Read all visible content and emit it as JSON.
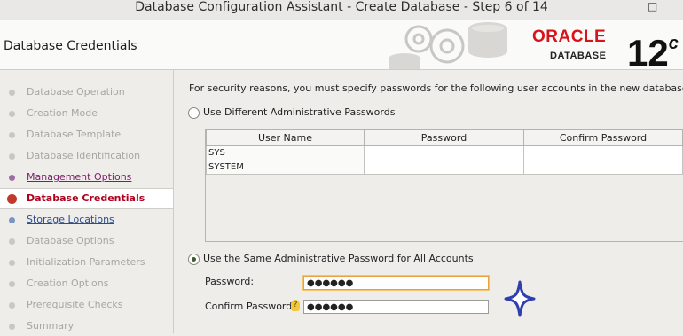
{
  "window": {
    "title": "Database Configuration Assistant - Create Database - Step 6 of 14",
    "minimize": "_",
    "maximize": "□"
  },
  "header": {
    "page_title": "Database Credentials",
    "logo_text": "ORACLE",
    "logo_sub": "DATABASE",
    "version": "12",
    "version_sup": "c"
  },
  "sidebar": {
    "items": [
      {
        "label": "Database Operation",
        "state": "disabled"
      },
      {
        "label": "Creation Mode",
        "state": "disabled"
      },
      {
        "label": "Database Template",
        "state": "disabled"
      },
      {
        "label": "Database Identification",
        "state": "disabled"
      },
      {
        "label": "Management Options",
        "state": "visited"
      },
      {
        "label": "Database Credentials",
        "state": "active"
      },
      {
        "label": "Storage Locations",
        "state": "link"
      },
      {
        "label": "Database Options",
        "state": "disabled"
      },
      {
        "label": "Initialization Parameters",
        "state": "disabled"
      },
      {
        "label": "Creation Options",
        "state": "disabled"
      },
      {
        "label": "Prerequisite Checks",
        "state": "disabled"
      },
      {
        "label": "Summary",
        "state": "disabled"
      }
    ]
  },
  "main": {
    "intro": "For security reasons, you must specify passwords for the following user accounts in the new database.",
    "option_different": "Use Different Administrative Passwords",
    "option_same": "Use the Same Administrative Password for All Accounts",
    "selected_option": "same",
    "table": {
      "columns": [
        "User Name",
        "Password",
        "Confirm Password"
      ],
      "rows": [
        {
          "user": "SYS",
          "password": "",
          "confirm": ""
        },
        {
          "user": "SYSTEM",
          "password": "",
          "confirm": ""
        }
      ]
    },
    "password_label": "Password:",
    "password_value": "●●●●●●",
    "confirm_label": "Confirm Password:",
    "confirm_value": "●●●●●●",
    "hint_icon": "?"
  },
  "colors": {
    "oracle_red": "#d8131b",
    "active_step": "#b00020",
    "link": "#2b4f8a",
    "visited": "#7a1f6a",
    "focus_border": "#e8a33c",
    "sparkle": "#2f3fb0"
  }
}
